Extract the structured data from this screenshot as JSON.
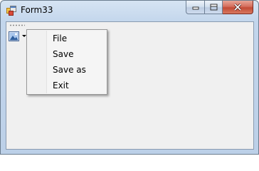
{
  "window": {
    "title": "Form33",
    "icon": "app-form-icon",
    "caption_buttons": [
      "minimize-icon",
      "maximize-icon",
      "close-icon"
    ]
  },
  "toolstrip": {
    "dropdown_icon": "image-icon"
  },
  "menu": {
    "items": [
      {
        "label": "File"
      },
      {
        "label": "Save"
      },
      {
        "label": "Save as"
      },
      {
        "label": "Exit"
      }
    ]
  }
}
